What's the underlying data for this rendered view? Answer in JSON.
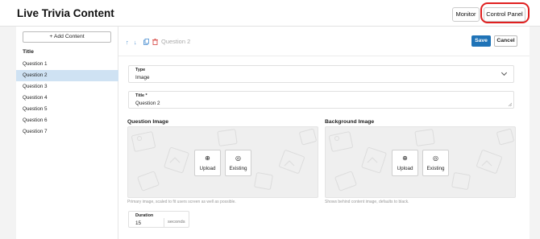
{
  "header": {
    "title": "Live Trivia Content",
    "monitor_label": "Monitor",
    "control_panel_label": "Control Panel",
    "highlight_color": "#e02020"
  },
  "sidebar": {
    "add_label": "+ Add Content",
    "list_header": "Title",
    "items": [
      {
        "label": "Question 1",
        "selected": false
      },
      {
        "label": "Question 2",
        "selected": true
      },
      {
        "label": "Question 3",
        "selected": false
      },
      {
        "label": "Question 4",
        "selected": false
      },
      {
        "label": "Question 5",
        "selected": false
      },
      {
        "label": "Question 6",
        "selected": false
      },
      {
        "label": "Question 7",
        "selected": false
      }
    ]
  },
  "editor": {
    "toolbar_icons": [
      "arrow-up-icon",
      "arrow-down-icon",
      "copy-icon",
      "trash-icon"
    ],
    "editing_title": "Question 2",
    "save_label": "Save",
    "cancel_label": "Cancel",
    "type_field": {
      "label": "Type",
      "value": "Image"
    },
    "title_field": {
      "label": "Title *",
      "value": "Question 2"
    },
    "question_image": {
      "label": "Question Image",
      "upload_label": "Upload",
      "existing_label": "Existing",
      "helper": "Primary image, scaled to fit users screen as well as possible."
    },
    "background_image": {
      "label": "Background Image",
      "upload_label": "Upload",
      "existing_label": "Existing",
      "helper": "Shows behind content image, defaults to black."
    },
    "duration": {
      "label": "Duration",
      "value": "15",
      "unit": "seconds"
    }
  },
  "colors": {
    "accent": "#1f73b7",
    "selected_row": "#cfe2f3",
    "delete": "#d9534f"
  }
}
